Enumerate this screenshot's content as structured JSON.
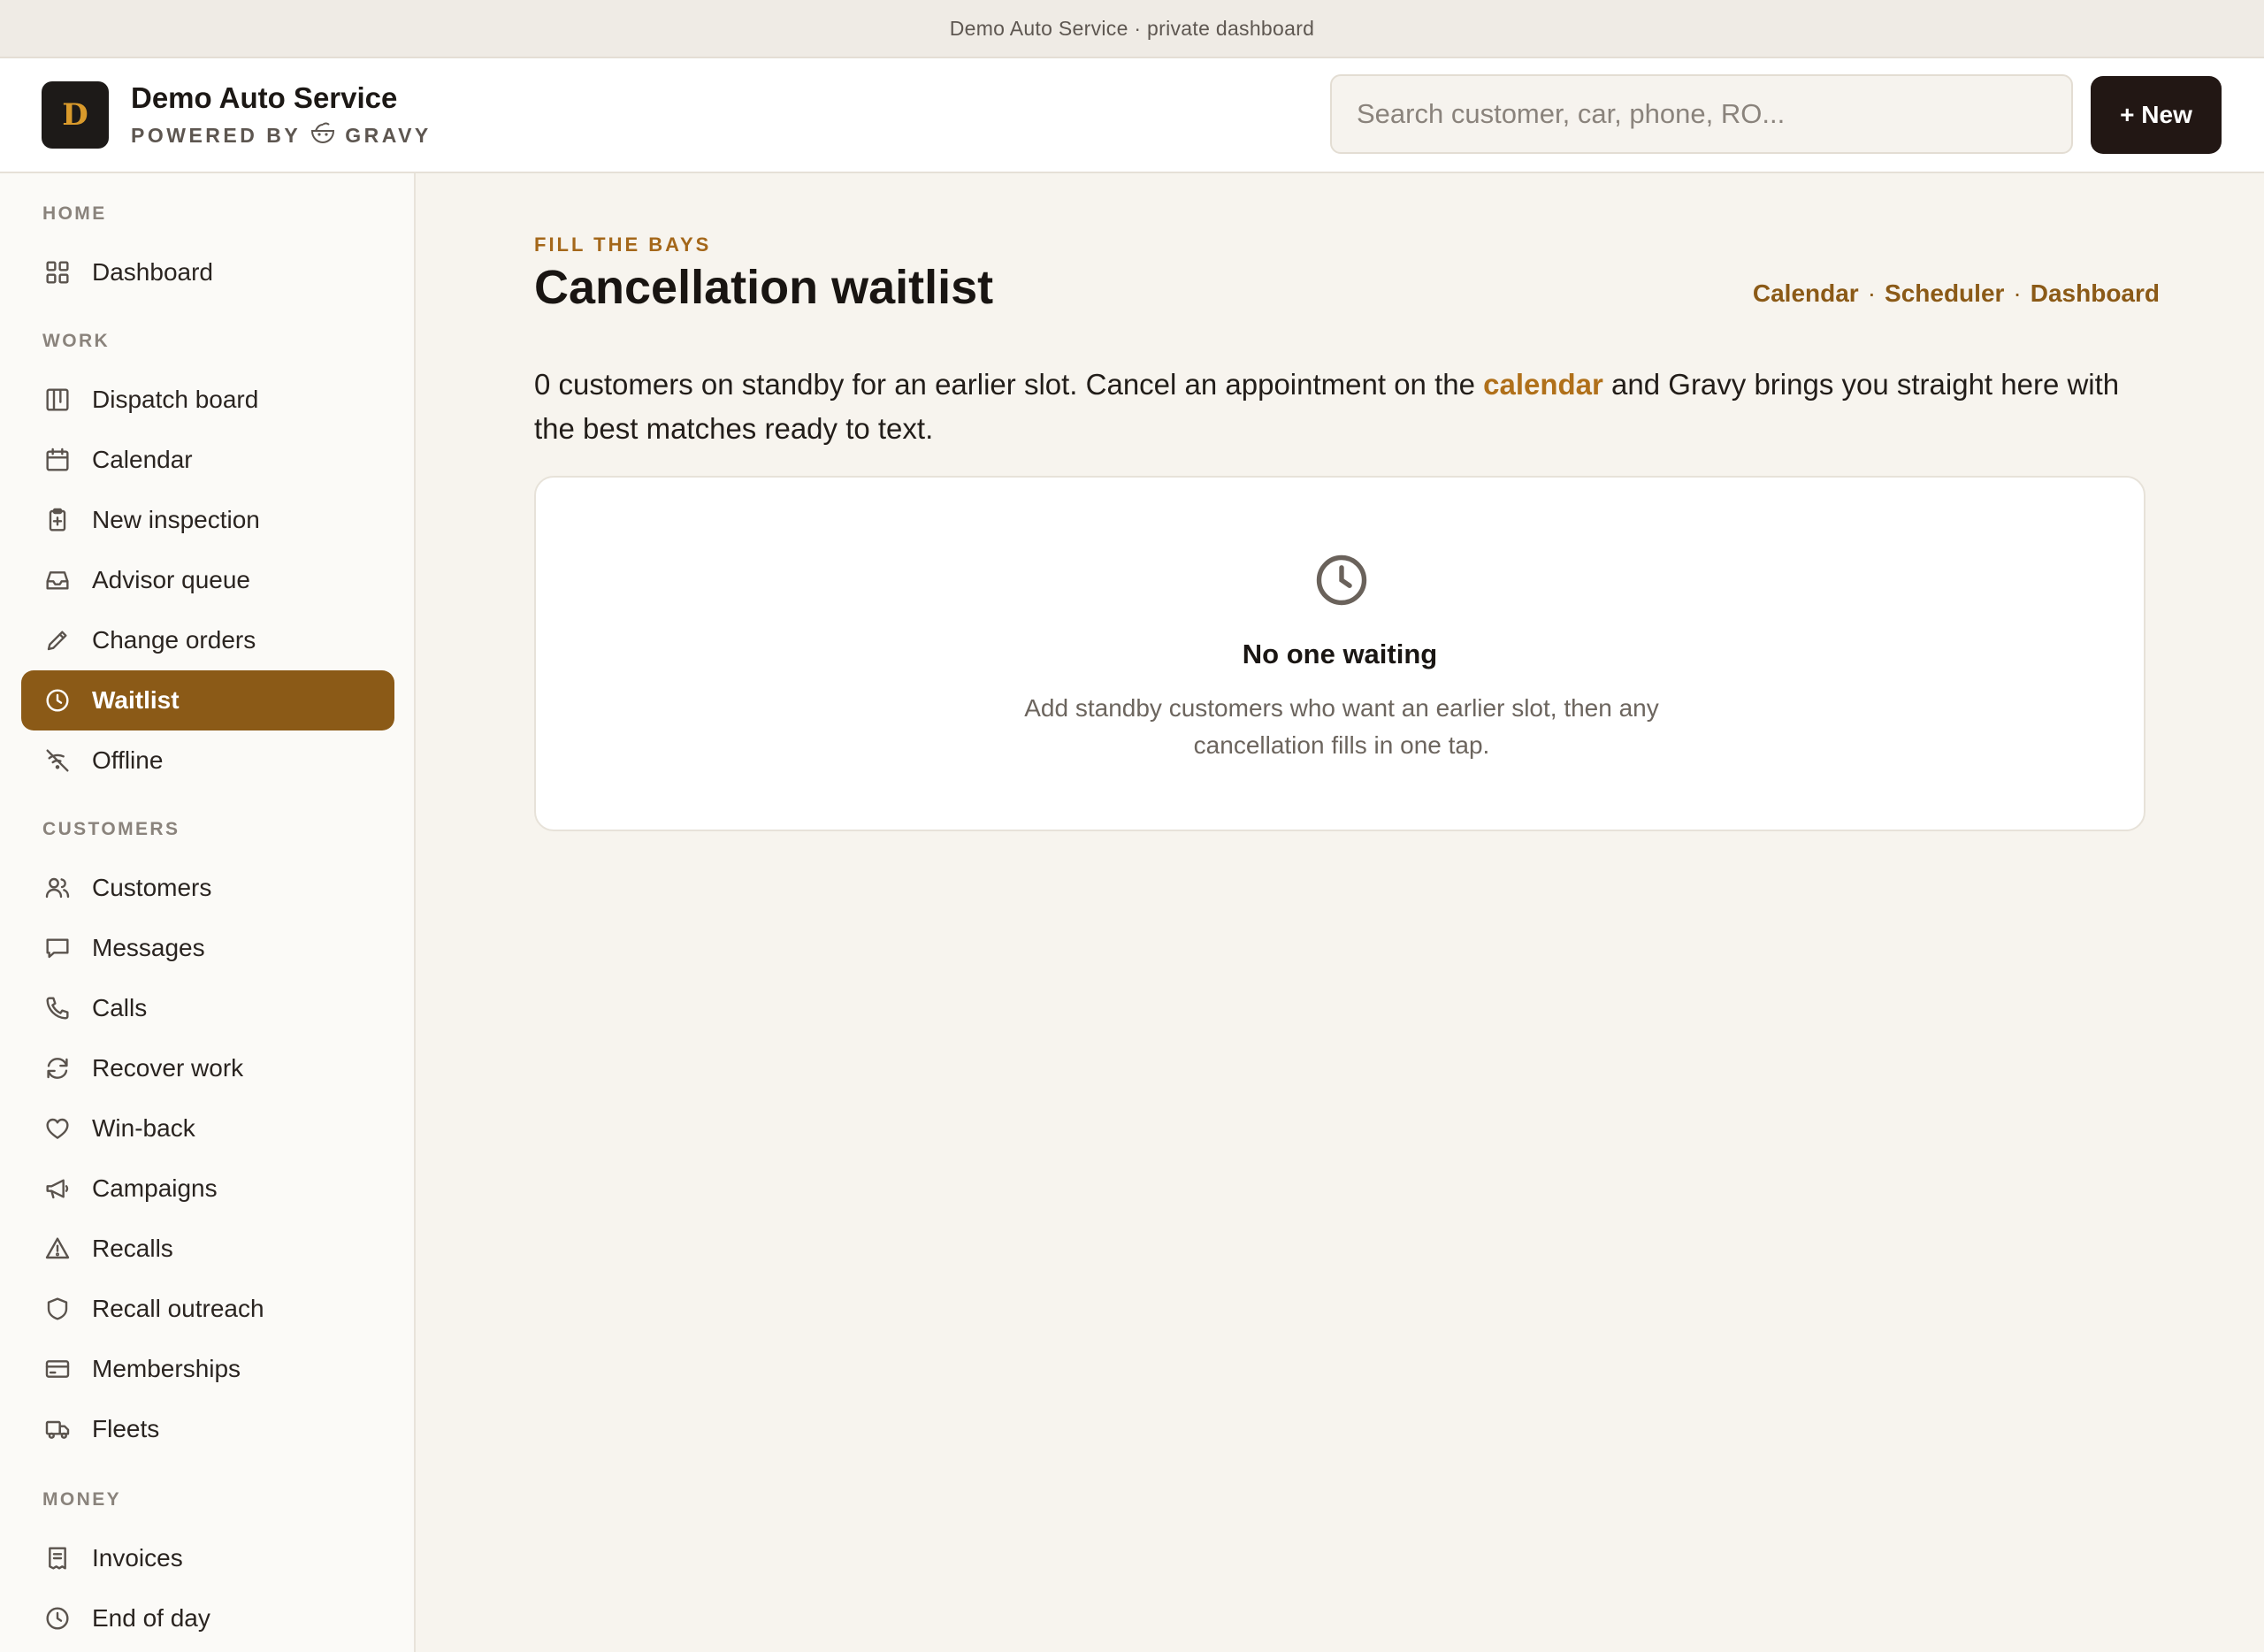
{
  "topbar": {
    "text": "Demo Auto Service · private dashboard"
  },
  "header": {
    "logo_letter": "D",
    "brand_name": "Demo Auto Service",
    "powered_by": "POWERED BY",
    "powered_brand": "GRAVY",
    "search_placeholder": "Search customer, car, phone, RO...",
    "new_button": "+ New"
  },
  "sidebar": {
    "sections": {
      "home": "HOME",
      "work": "WORK",
      "customers": "CUSTOMERS",
      "money": "MONEY"
    },
    "items": {
      "dashboard": {
        "label": "Dashboard",
        "icon": "grid-icon"
      },
      "dispatch": {
        "label": "Dispatch board",
        "icon": "kanban-icon"
      },
      "calendar": {
        "label": "Calendar",
        "icon": "calendar-icon"
      },
      "inspection": {
        "label": "New inspection",
        "icon": "clipboard-plus-icon"
      },
      "advisor": {
        "label": "Advisor queue",
        "icon": "inbox-icon"
      },
      "change_orders": {
        "label": "Change orders",
        "icon": "pencil-icon"
      },
      "waitlist": {
        "label": "Waitlist",
        "icon": "clock-icon",
        "active": true
      },
      "offline": {
        "label": "Offline",
        "icon": "wifi-off-icon"
      },
      "customers": {
        "label": "Customers",
        "icon": "users-icon"
      },
      "messages": {
        "label": "Messages",
        "icon": "message-icon"
      },
      "calls": {
        "label": "Calls",
        "icon": "phone-icon"
      },
      "recover": {
        "label": "Recover work",
        "icon": "refresh-icon"
      },
      "winback": {
        "label": "Win-back",
        "icon": "heart-icon"
      },
      "campaigns": {
        "label": "Campaigns",
        "icon": "megaphone-icon"
      },
      "recalls": {
        "label": "Recalls",
        "icon": "warning-icon"
      },
      "recall_outreach": {
        "label": "Recall outreach",
        "icon": "shield-icon"
      },
      "memberships": {
        "label": "Memberships",
        "icon": "card-icon"
      },
      "fleets": {
        "label": "Fleets",
        "icon": "truck-icon"
      },
      "invoices": {
        "label": "Invoices",
        "icon": "receipt-icon"
      },
      "end_of_day": {
        "label": "End of day",
        "icon": "clock-icon"
      }
    }
  },
  "main": {
    "eyebrow": "FILL THE BAYS",
    "title": "Cancellation waitlist",
    "crumbs": {
      "calendar": "Calendar",
      "scheduler": "Scheduler",
      "dashboard": "Dashboard",
      "separator": "·"
    },
    "intro": {
      "before": "0 customers on standby for an earlier slot. Cancel an appointment on the ",
      "link": "calendar",
      "after": " and Gravy brings you straight here with the best matches ready to text."
    },
    "empty": {
      "title": "No one waiting",
      "description": "Add standby customers who want an earlier slot, then any cancellation fills in one tap."
    }
  },
  "colors": {
    "accent": "#8b5a17",
    "accent_text": "#a4671a",
    "page_bg": "#f7f4ee",
    "dark_button": "#221714"
  }
}
